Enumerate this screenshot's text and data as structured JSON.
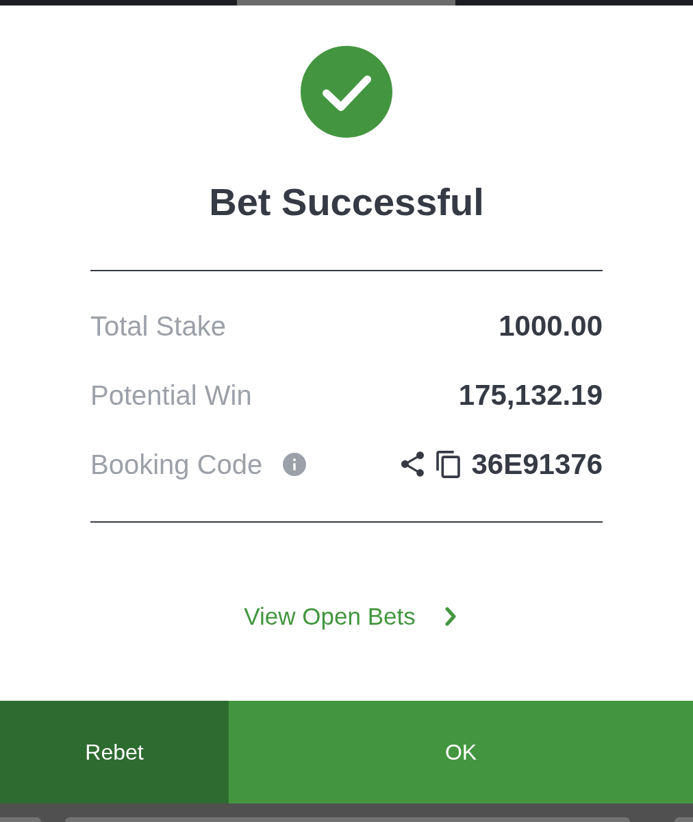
{
  "title": "Bet Successful",
  "details": [
    {
      "kind": "amount",
      "label": "Total Stake",
      "value": "1000.00"
    },
    {
      "kind": "amount",
      "label": "Potential Win",
      "value": "175,132.19"
    },
    {
      "kind": "code",
      "label": "Booking Code",
      "value": "36E91376"
    }
  ],
  "link": {
    "label": "View Open Bets"
  },
  "buttons": [
    {
      "kind": "secondary",
      "label": "Rebet"
    },
    {
      "kind": "primary",
      "label": "OK"
    }
  ]
}
